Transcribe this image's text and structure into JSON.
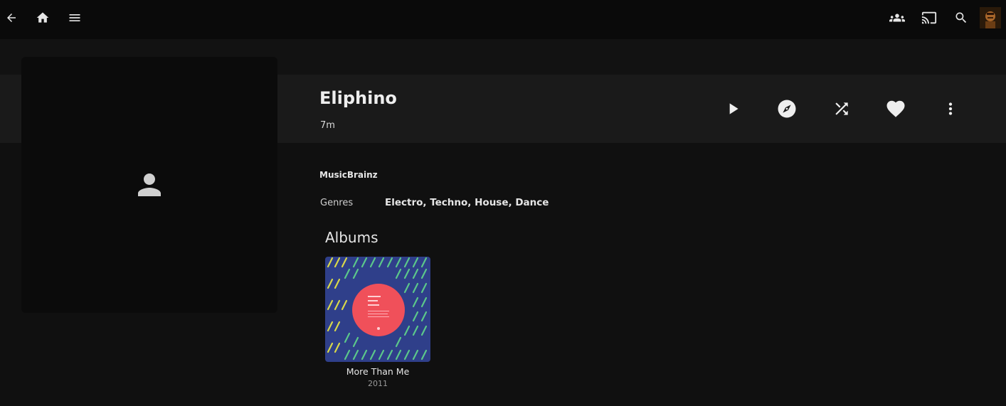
{
  "header": {
    "icons": [
      "back-arrow-icon",
      "home-icon",
      "menu-icon",
      "people-icon",
      "cast-icon",
      "search-icon",
      "user-avatar"
    ]
  },
  "artist": {
    "name": "Eliphino",
    "runtime": "7m",
    "external_link": "MusicBrainz",
    "genres_label": "Genres",
    "genres": "Electro, Techno, House, Dance"
  },
  "actions": [
    "play-icon",
    "instant-mix-icon",
    "shuffle-icon",
    "favorite-icon",
    "more-icon"
  ],
  "albums": {
    "heading": "Albums",
    "items": [
      {
        "name": "More Than Me",
        "year": "2011"
      }
    ]
  },
  "colors": {
    "background": "#101010",
    "topbar": "#0a0a0a",
    "band": "#1a1a1a",
    "album_art_bg": "#2f3f8a",
    "album_disc": "#f0505a"
  }
}
